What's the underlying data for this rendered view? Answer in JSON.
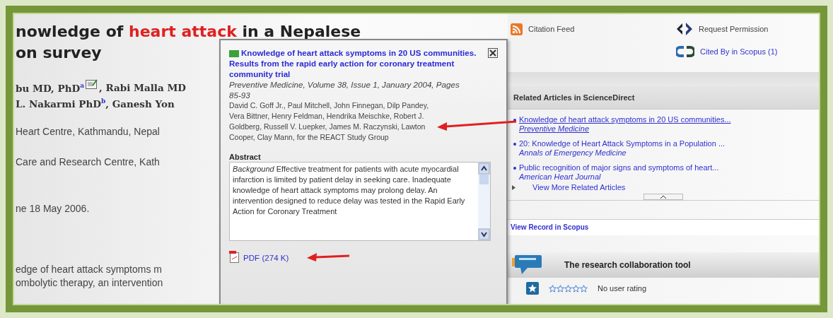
{
  "article": {
    "title": [
      {
        "text": "nowledge of ",
        "highlight": false
      },
      {
        "text": "heart attack",
        "highlight": true
      },
      {
        "text": " in a Nepalese",
        "highlight": false
      }
    ],
    "title_line_2": "on survey",
    "authors": [
      {
        "before": "bu MD, PhD$^{a}$",
        "email_icon": true,
        "after": ", Rabi Malla MD"
      },
      {
        "before": "L. Nakarmi PhD$^{b}$, Ganesh Yon",
        "email_icon": false
      }
    ],
    "affiliations": [
      "Heart Centre, Kathmandu, Nepal",
      "Care and Research Centre, Kath"
    ],
    "received": "ne 18 May 2006.",
    "abstract_lines": [
      "edge of heart attack symptoms m",
      "ombolytic therapy, an intervention"
    ]
  },
  "popup": {
    "title": "Knowledge of heart attack symptoms in 20 US communities. Results from the rapid early action for coronary treatment community trial",
    "citation": "Preventive Medicine, Volume 38, Issue 1, January 2004, Pages 85-93",
    "authors": "David C. Goff Jr., Paul Mitchell, John Finnegan, Dilp Pandey, Vera Bittner, Henry Feldman, Hendrika Meischke, Robert J. Goldberg, Russell V. Luepker, James M. Raczynski, Lawton Cooper, Clay Mann, for the REACT Study Group",
    "abstract_heading": "Abstract",
    "abstract": "*Background* Effective treatment for patients with acute myocardial infarction is limited by patient delay in seeking care. Inadequate knowledge of heart attack symptoms may prolong delay. An intervention designed to reduce delay was tested in the Rapid Early Action for Coronary Treatment",
    "pdf_link": "PDF (274 K)"
  },
  "sidebar": {
    "actions": [
      {
        "kind": "rss",
        "label": "Citation Feed",
        "link": false
      },
      {
        "kind": "permission",
        "label": "Request Permission",
        "link": false
      },
      {
        "kind": "scopus",
        "label": "Cited By in Scopus (1)",
        "link": true
      }
    ],
    "related": {
      "heading": "Related Articles in ScienceDirect",
      "items": [
        {
          "title": "Knowledge of heart attack symptoms in 20 US communities...",
          "journal": "Preventive Medicine",
          "underlined": true
        },
        {
          "title": "20: Knowledge of Heart Attack Symptoms in a Population ...",
          "journal": "Annals of Emergency Medicine",
          "underlined": false
        },
        {
          "title": "Public recognition of major signs and symptoms of heart...",
          "journal": "American Heart Journal",
          "underlined": false
        }
      ],
      "more": "View More Related Articles"
    },
    "view_record": "View Record in Scopus",
    "collab": {
      "heading": "The research collaboration tool",
      "rating": {
        "stars": 0,
        "label": "No user rating"
      }
    }
  }
}
